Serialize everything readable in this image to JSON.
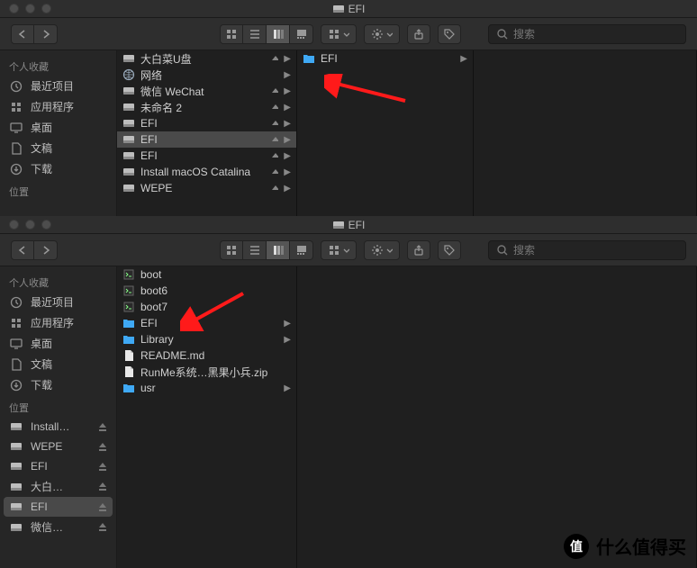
{
  "windows": [
    {
      "title": "EFI",
      "search_placeholder": "搜索",
      "sidebar": {
        "sections": [
          {
            "header": "个人收藏",
            "items": [
              {
                "label": "最近项目",
                "icon": "clock"
              },
              {
                "label": "应用程序",
                "icon": "apps"
              },
              {
                "label": "桌面",
                "icon": "desktop"
              },
              {
                "label": "文稿",
                "icon": "doc"
              },
              {
                "label": "下载",
                "icon": "download"
              }
            ]
          },
          {
            "header": "位置",
            "items": []
          }
        ]
      },
      "columns": [
        [
          {
            "name": "大白菜U盘",
            "icon": "drive",
            "eject": true,
            "chev": true
          },
          {
            "name": "网络",
            "icon": "globe",
            "chev": true
          },
          {
            "name": "微信 WeChat",
            "icon": "drive",
            "eject": true,
            "chev": true
          },
          {
            "name": "未命名 2",
            "icon": "drive",
            "eject": true,
            "chev": true
          },
          {
            "name": "EFI",
            "icon": "drive",
            "eject": true,
            "chev": true
          },
          {
            "name": "EFI",
            "icon": "drive",
            "eject": true,
            "chev": true,
            "selected": true
          },
          {
            "name": "EFI",
            "icon": "drive",
            "eject": true,
            "chev": true
          },
          {
            "name": "Install macOS Catalina",
            "icon": "drive",
            "eject": true,
            "chev": true
          },
          {
            "name": "WEPE",
            "icon": "drive",
            "eject": true,
            "chev": true
          }
        ],
        [
          {
            "name": "EFI",
            "icon": "folder",
            "chev": true
          }
        ]
      ]
    },
    {
      "title": "EFI",
      "search_placeholder": "搜索",
      "sidebar": {
        "sections": [
          {
            "header": "个人收藏",
            "items": [
              {
                "label": "最近项目",
                "icon": "clock"
              },
              {
                "label": "应用程序",
                "icon": "apps"
              },
              {
                "label": "桌面",
                "icon": "desktop"
              },
              {
                "label": "文稿",
                "icon": "doc"
              },
              {
                "label": "下载",
                "icon": "download"
              }
            ]
          },
          {
            "header": "位置",
            "items": [
              {
                "label": "Install…",
                "icon": "drive",
                "eject": true
              },
              {
                "label": "WEPE",
                "icon": "drive",
                "eject": true
              },
              {
                "label": "EFI",
                "icon": "drive",
                "eject": true
              },
              {
                "label": "大白…",
                "icon": "drive",
                "eject": true
              },
              {
                "label": "EFI",
                "icon": "drive",
                "eject": true,
                "selected": true
              },
              {
                "label": "微信…",
                "icon": "drive",
                "eject": true
              }
            ]
          }
        ]
      },
      "columns": [
        [
          {
            "name": "boot",
            "icon": "exec"
          },
          {
            "name": "boot6",
            "icon": "exec"
          },
          {
            "name": "boot7",
            "icon": "exec"
          },
          {
            "name": "EFI",
            "icon": "folder",
            "chev": true
          },
          {
            "name": "Library",
            "icon": "folder",
            "chev": true
          },
          {
            "name": "README.md",
            "icon": "file"
          },
          {
            "name": "RunMe系统…黑果小兵.zip",
            "icon": "file"
          },
          {
            "name": "usr",
            "icon": "folder",
            "chev": true
          }
        ]
      ]
    }
  ],
  "watermark": {
    "badge": "值",
    "text": "什么值得买"
  }
}
